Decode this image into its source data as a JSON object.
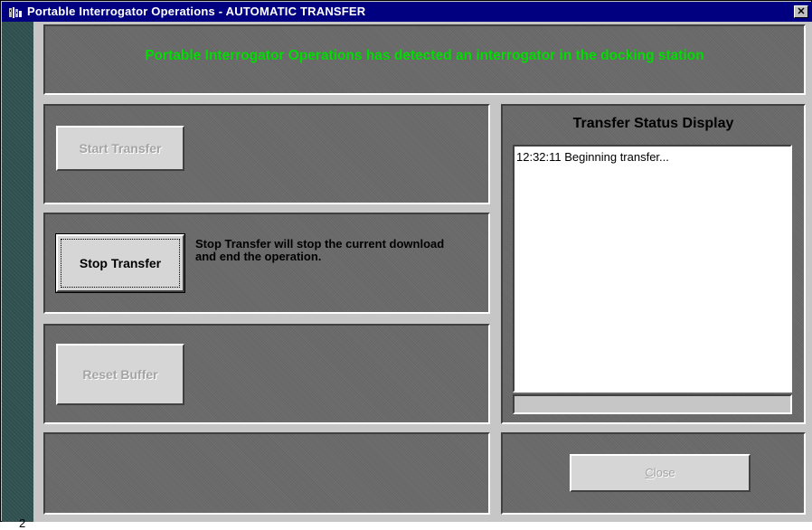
{
  "window": {
    "title": "Portable Interrogator Operations  -  AUTOMATIC TRANSFER",
    "close_glyph": "✕",
    "strip_number": "2"
  },
  "banner": {
    "message": "Portable Interrogator Operations has detected an interrogator in the docking station",
    "color": "#00dd00"
  },
  "buttons": {
    "start_transfer": "Start Transfer",
    "stop_transfer": "Stop Transfer",
    "reset_buffer": "Reset Buffer",
    "close_mnemonic": "C",
    "close_rest": "lose"
  },
  "stop_description": "Stop Transfer will stop the current download and end the operation.",
  "status": {
    "title": "Transfer Status Display",
    "log": [
      "12:32:11 Beginning transfer..."
    ],
    "progress": 0
  },
  "colors": {
    "title_bar": "#000080",
    "panel": "#707070",
    "banner_text": "#00dd00"
  }
}
